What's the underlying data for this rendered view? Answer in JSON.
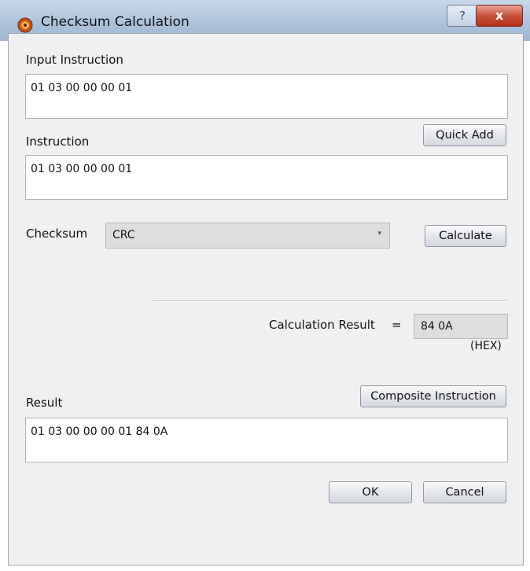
{
  "window": {
    "title": "Checksum Calculation",
    "help_glyph": "?",
    "close_glyph": "x"
  },
  "input_instruction": {
    "label": "Input Instruction",
    "value": "01 03 00 00 00 01"
  },
  "quick_add_label": "Quick Add",
  "instruction": {
    "label": "Instruction",
    "value": "01 03 00 00 00 01"
  },
  "checksum": {
    "label": "Checksum",
    "selected": "CRC",
    "arrow": "▾"
  },
  "calculate_label": "Calculate",
  "calc_result": {
    "label": "Calculation Result",
    "equals": "=",
    "value": "84 0A",
    "unit": "(HEX)"
  },
  "result": {
    "label": "Result",
    "value": "01 03 00 00 00 01 84 0A"
  },
  "composite_label": "Composite Instruction",
  "ok_label": "OK",
  "cancel_label": "Cancel"
}
